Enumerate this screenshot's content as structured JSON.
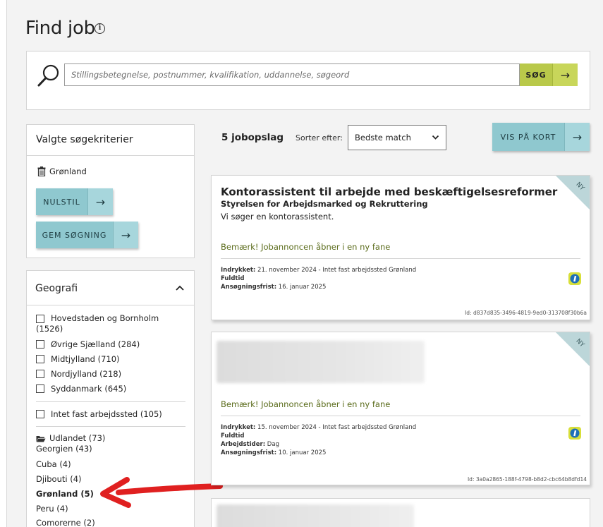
{
  "page": {
    "title": "Find job"
  },
  "search": {
    "placeholder": "Stillingsbetegnelse, postnummer, kvalifikation, uddannelse, søgeord",
    "button_label": "SØG"
  },
  "criteria": {
    "title": "Valgte søgekriterier",
    "selected": [
      "Grønland"
    ],
    "reset_label": "NULSTIL",
    "save_label": "GEM SØGNING"
  },
  "geography": {
    "title": "Geografi",
    "regions": [
      {
        "label": "Hovedstaden og Bornholm",
        "count": "(1526)",
        "checked": false
      },
      {
        "label": "Øvrige Sjælland (284)",
        "checked": false
      },
      {
        "label": "Midtjylland (710)",
        "checked": false
      },
      {
        "label": "Nordjylland (218)",
        "checked": false
      },
      {
        "label": "Syddanmark (645)",
        "checked": false
      }
    ],
    "no_fixed": {
      "label": "Intet fast arbejdssted (105)",
      "checked": false
    },
    "abroad": {
      "label": "Udlandet (73)",
      "countries": [
        "Georgien (43)",
        "Cuba (4)",
        "Djibouti (4)",
        "Grønland (5)",
        "Peru (4)",
        "Comorerne (2)"
      ]
    }
  },
  "results": {
    "count_label": "5 jobopslag",
    "sort_label": "Sorter efter:",
    "sort_value": "Bedste match",
    "map_button": "VIS PÅ KORT"
  },
  "jobs": [
    {
      "badge": "NY",
      "title": "Kontorassistent til arbejde med beskæftigelsesreformer",
      "company": "Styrelsen for Arbejdsmarked og Rekruttering",
      "description": "Vi søger en kontorassistent.",
      "notice": "Bemærk! Jobannoncen åbner i en ny fane",
      "posted_label": "Indrykket:",
      "posted_value": " 21. november 2024 - Intet fast arbejdssted Grønland",
      "type": "Fuldtid",
      "deadline_label": "Ansøgningsfrist:",
      "deadline_value": " 16. januar 2025",
      "id": "Id: d837d835-3496-4819-9ed0-313708f30b6a"
    },
    {
      "badge": "NY",
      "notice": "Bemærk! Jobannoncen åbner i en ny fane",
      "posted_label": "Indrykket:",
      "posted_value": " 15. november 2024 - Intet fast arbejdssted Grønland",
      "type": "Fuldtid",
      "hours_label": "Arbejdstider:",
      "hours_value": " Dag",
      "deadline_label": "Ansøgningsfrist:",
      "deadline_value": " 10. januar 2025",
      "id": "Id: 3a0a2865-188f-4798-b8d2-cbc64b8dfd14"
    }
  ],
  "colors": {
    "teal_button": "#8fc8cf",
    "search_button": "#b9c94a",
    "annotation_arrow": "#e02020",
    "notice_text": "#5a6b1a"
  },
  "icons": {
    "search": "magnifier-icon",
    "info": "info-icon",
    "trash": "trash-icon",
    "folder": "folder-open-icon",
    "chevron_up": "chevron-up-icon",
    "chevron_down": "chevron-down-icon",
    "jobnet": "jobnet-logo-icon"
  }
}
